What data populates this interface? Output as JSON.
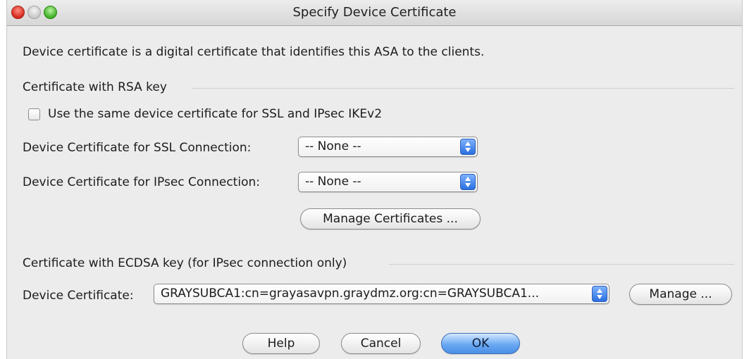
{
  "window": {
    "title": "Specify Device Certificate"
  },
  "intro": "Device certificate is a digital certificate that identifies this ASA to the clients.",
  "rsa": {
    "section_label": "Certificate with RSA key",
    "same_cert_checkbox_label": "Use the same device certificate for SSL and IPsec IKEv2",
    "same_cert_checked": false,
    "ssl_label": "Device Certificate for SSL Connection:",
    "ssl_value": "-- None --",
    "ipsec_label": "Device Certificate for IPsec Connection:",
    "ipsec_value": "-- None --",
    "manage_button": "Manage Certificates ..."
  },
  "ecdsa": {
    "section_label": "Certificate with ECDSA key (for IPsec connection only)",
    "device_cert_label": "Device Certificate:",
    "device_cert_value": "GRAYSUBCA1:cn=grayasavpn.graydmz.org:cn=GRAYSUBCA1...",
    "manage_button": "Manage ..."
  },
  "buttons": {
    "help": "Help",
    "cancel": "Cancel",
    "ok": "OK"
  }
}
